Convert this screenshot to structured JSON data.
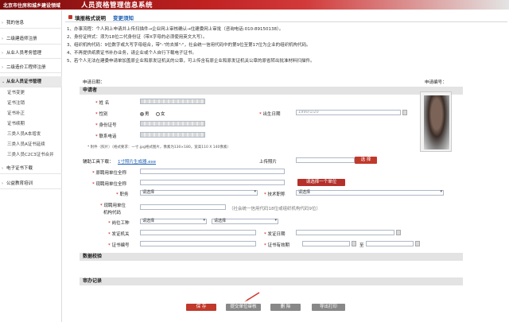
{
  "banner": {
    "org": "北京市住房和城乡建设领域",
    "system": "人员资格管理信息系统"
  },
  "sidebar": {
    "items": [
      {
        "label": "我的信息"
      },
      {
        "label": "二级建造师注册"
      },
      {
        "label": "从业人员考务管理"
      },
      {
        "label": "二级造价工程师注册"
      },
      {
        "label": "从业人员证书管理"
      }
    ],
    "subitems": [
      "证书变更",
      "证书注销",
      "证书补正",
      "证书续期",
      "三类人员A本增发",
      "三类人员A证书延续",
      "三类人员C2C3证书合并"
    ],
    "items2": [
      {
        "label": "电子证书下载"
      },
      {
        "label": "公益教育培训"
      }
    ]
  },
  "tabs": {
    "tab1": "填报格式说明",
    "tab2": "变更须知"
  },
  "notes": [
    "1、办事流程：个人网上申请并上传扫描件→企业网上审核确认→住建委网上审批（咨询电话:010-89150138）。",
    "2、身份证样式：须为18位二代身份证（带X字母的必须使用英文大写）。",
    "3、组织机构代码：9位数字或大写字母组合，带\"-\"的去掉\"-\"，社会统一信用代码中的第9位至第17位为企业的组织机构代码。",
    "4、不再提供纸质证书补办业务，请企业或个人自行下载电子证书。",
    "5、若个人无法在建委申请单加盖原企业和原发证机关的公章，可上传含有原企业和原发证机关公章的原省转出批准材料扫描件。"
  ],
  "form": {
    "apply_date_label": "申请日期：",
    "apply_no_label": "申请编号：",
    "section_applicant": "申请者",
    "name_label": "姓 名",
    "gender_label": "性别",
    "male": "男",
    "female": "女",
    "birth_label": "出生日期",
    "birth_value": "1990/1/20",
    "idno_label": "身份证号",
    "phone_label": "联系电话",
    "attach_label": "* 附件（照片）（格式要求：一寸.jpg格式图片，像素为130×180，宽高110 X 140像素）",
    "tool_label": "辅助工具下载：",
    "tool_link": "1寸照片生成器.exe",
    "upload_label": "上传照片",
    "choose_btn": "选 择",
    "orig_unit_label": "原聘用单位全称",
    "cur_unit_label": "现聘用单位全称",
    "select_unit_btn": "请选择一个单位",
    "duty_label": "职务",
    "duty_value": "请选择",
    "title_label": "技术职称",
    "title_value": "请选择",
    "org_code_label1": "现聘用单位",
    "org_code_label2": "机构代码",
    "org_code_hint": "（社会统一信用代码18位或组织机构代码9位）",
    "post_label": "岗位工种",
    "post_value1": "请选择",
    "post_value2": "请选择",
    "issuer_label": "发证机关",
    "issue_date_label": "发证日期",
    "cert_no_label": "证书编号",
    "valid_label": "证书有效期",
    "valid_to": "至",
    "section_check": "数据校验",
    "section_record": "审办记录"
  },
  "buttons": {
    "save": "保 存",
    "submit": "提交单位审核",
    "delete": "删 除",
    "export": "导出打印"
  },
  "colors": {
    "accent": "#c0392b",
    "link": "#1a5fb4"
  }
}
